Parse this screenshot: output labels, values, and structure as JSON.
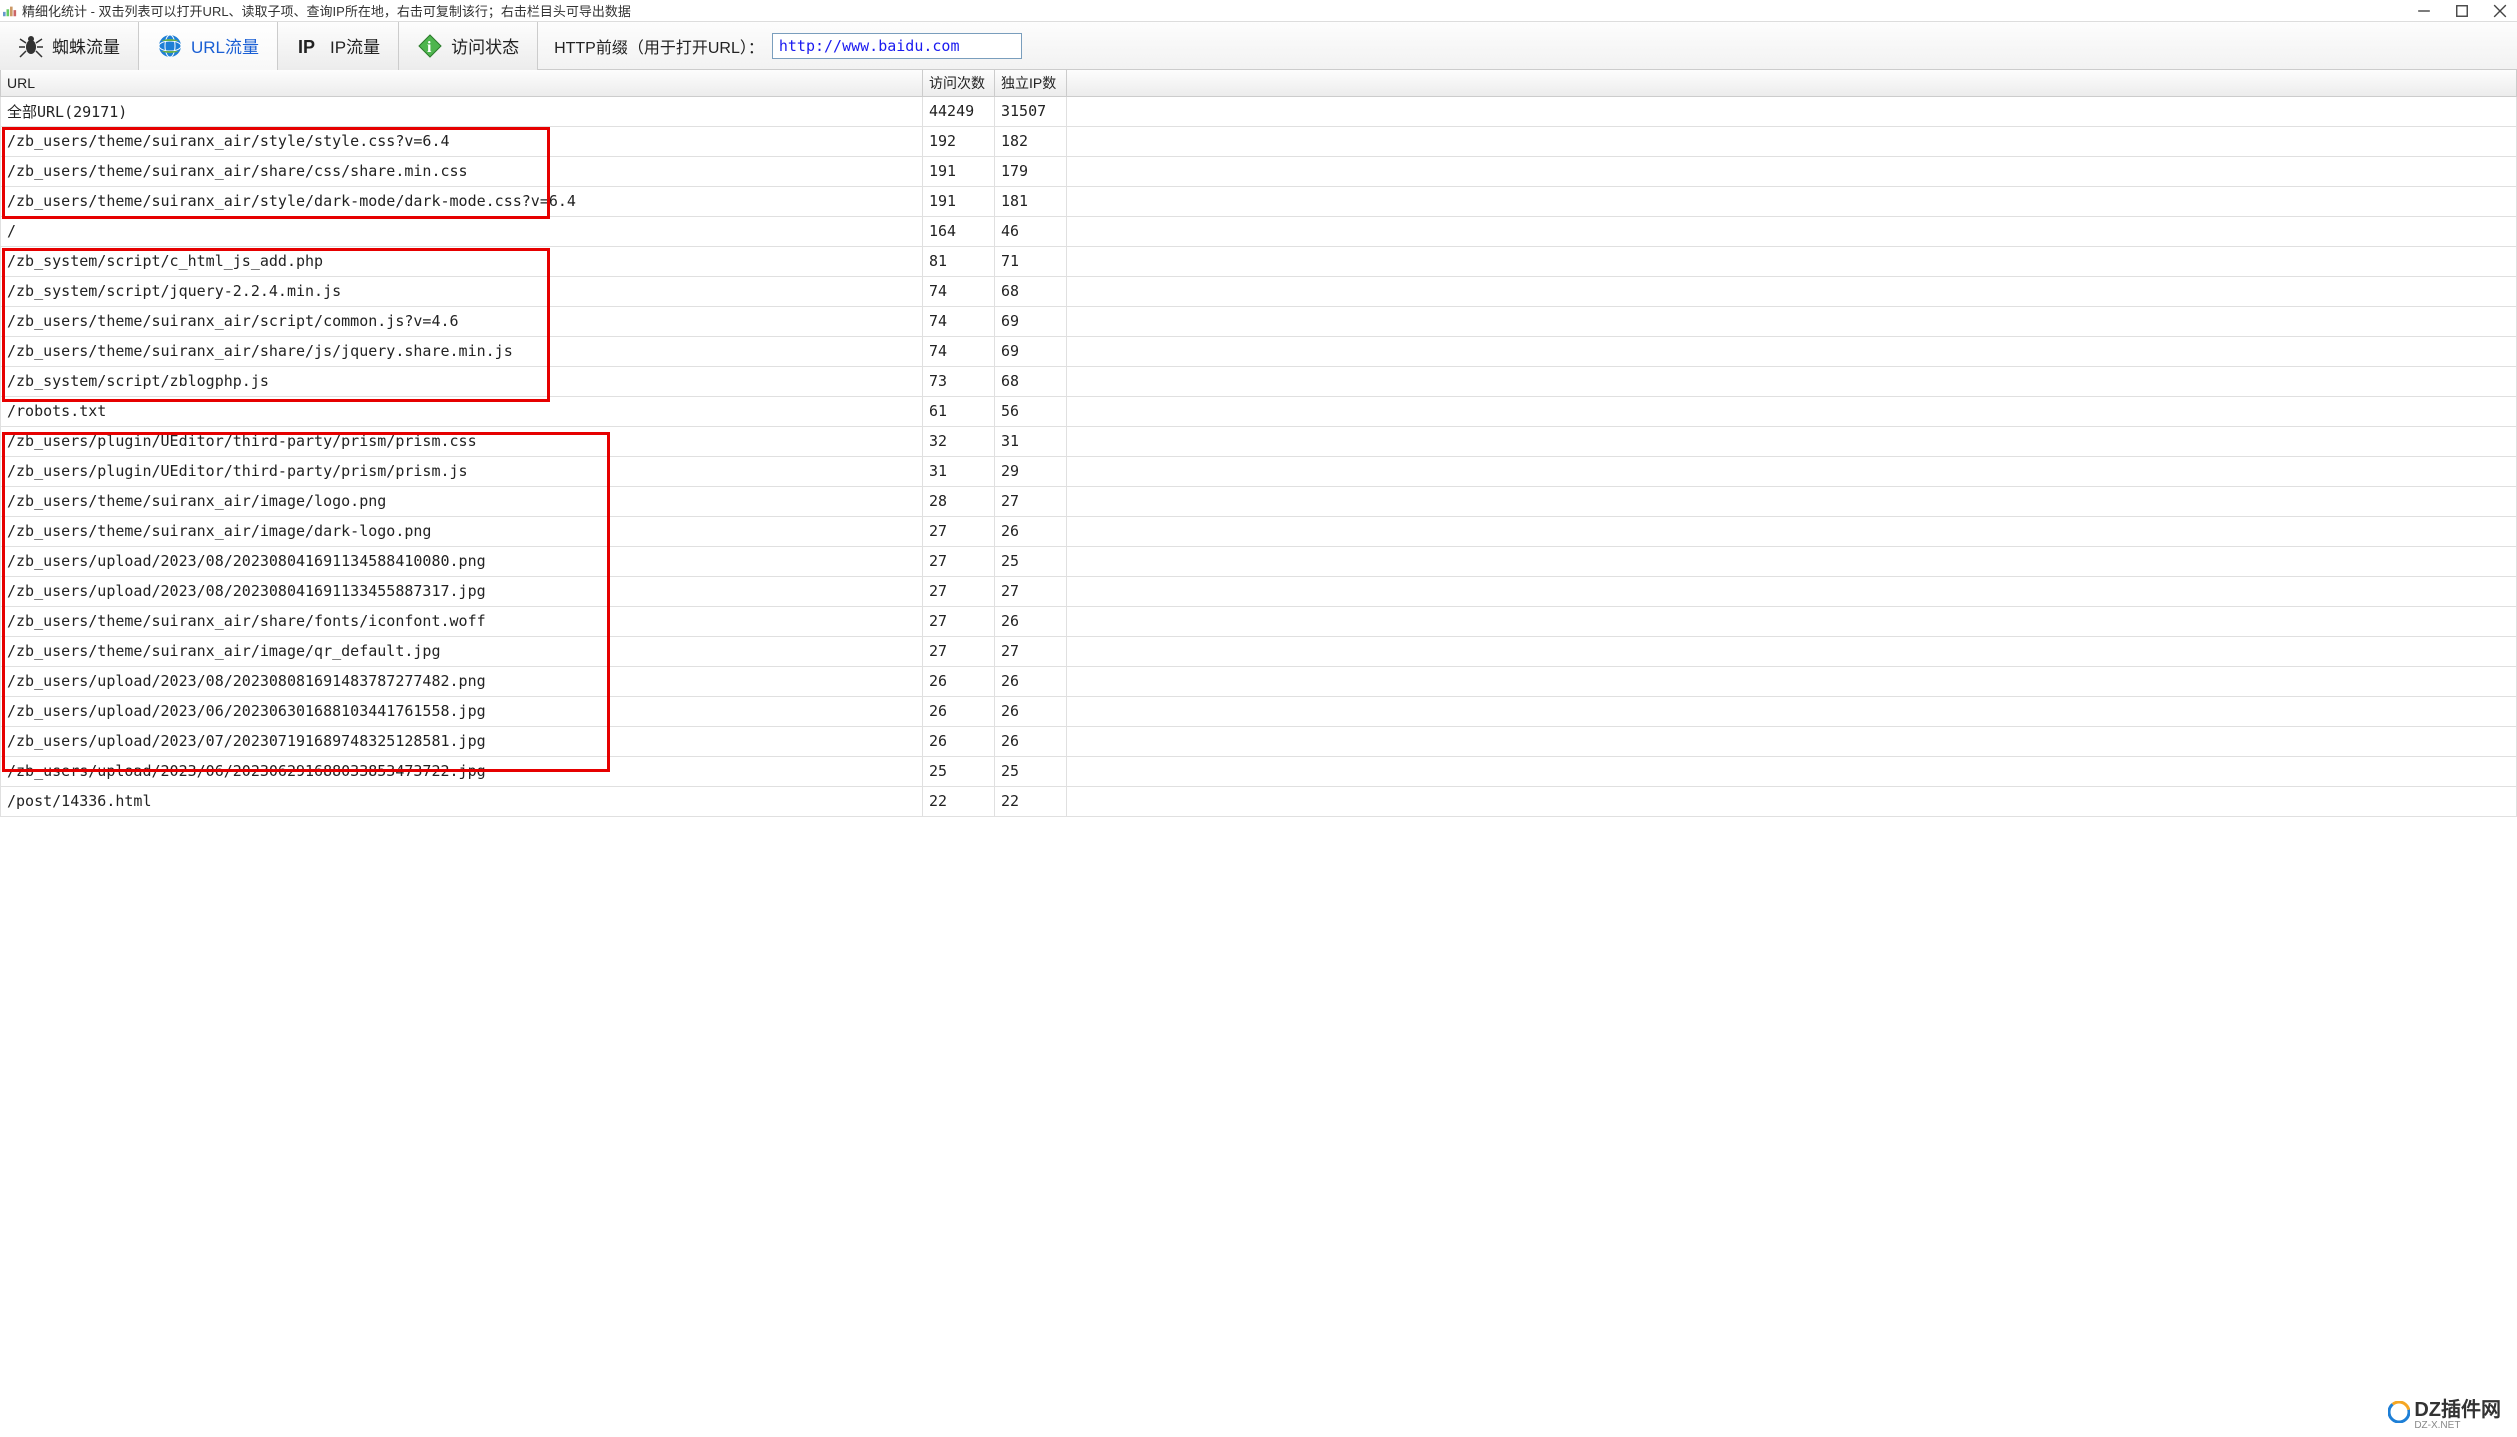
{
  "window": {
    "title": "精细化统计 - 双击列表可以打开URL、读取子项、查询IP所在地，右击可复制该行；右击栏目头可导出数据"
  },
  "tabs": {
    "spider": "蜘蛛流量",
    "url": "URL流量",
    "ip": "IP流量",
    "status": "访问状态"
  },
  "prefix": {
    "label": "HTTP前缀（用于打开URL）：",
    "value": "http://www.baidu.com"
  },
  "columns": {
    "url": "URL",
    "visits": "访问次数",
    "ip": "独立IP数"
  },
  "rows": [
    {
      "url": "全部URL(29171)",
      "visits": "44249",
      "ip": "31507"
    },
    {
      "url": "/zb_users/theme/suiranx_air/style/style.css?v=6.4",
      "visits": "192",
      "ip": "182"
    },
    {
      "url": "/zb_users/theme/suiranx_air/share/css/share.min.css",
      "visits": "191",
      "ip": "179"
    },
    {
      "url": "/zb_users/theme/suiranx_air/style/dark-mode/dark-mode.css?v=6.4",
      "visits": "191",
      "ip": "181"
    },
    {
      "url": "/",
      "visits": "164",
      "ip": "46"
    },
    {
      "url": "/zb_system/script/c_html_js_add.php",
      "visits": "81",
      "ip": "71"
    },
    {
      "url": "/zb_system/script/jquery-2.2.4.min.js",
      "visits": "74",
      "ip": "68"
    },
    {
      "url": "/zb_users/theme/suiranx_air/script/common.js?v=4.6",
      "visits": "74",
      "ip": "69"
    },
    {
      "url": "/zb_users/theme/suiranx_air/share/js/jquery.share.min.js",
      "visits": "74",
      "ip": "69"
    },
    {
      "url": "/zb_system/script/zblogphp.js",
      "visits": "73",
      "ip": "68"
    },
    {
      "url": "/robots.txt",
      "visits": "61",
      "ip": "56"
    },
    {
      "url": "/zb_users/plugin/UEditor/third-party/prism/prism.css",
      "visits": "32",
      "ip": "31"
    },
    {
      "url": "/zb_users/plugin/UEditor/third-party/prism/prism.js",
      "visits": "31",
      "ip": "29"
    },
    {
      "url": "/zb_users/theme/suiranx_air/image/logo.png",
      "visits": "28",
      "ip": "27"
    },
    {
      "url": "/zb_users/theme/suiranx_air/image/dark-logo.png",
      "visits": "27",
      "ip": "26"
    },
    {
      "url": "/zb_users/upload/2023/08/202308041691134588410080.png",
      "visits": "27",
      "ip": "25"
    },
    {
      "url": "/zb_users/upload/2023/08/202308041691133455887317.jpg",
      "visits": "27",
      "ip": "27"
    },
    {
      "url": "/zb_users/theme/suiranx_air/share/fonts/iconfont.woff",
      "visits": "27",
      "ip": "26"
    },
    {
      "url": "/zb_users/theme/suiranx_air/image/qr_default.jpg",
      "visits": "27",
      "ip": "27"
    },
    {
      "url": "/zb_users/upload/2023/08/202308081691483787277482.png",
      "visits": "26",
      "ip": "26"
    },
    {
      "url": "/zb_users/upload/2023/06/202306301688103441761558.jpg",
      "visits": "26",
      "ip": "26"
    },
    {
      "url": "/zb_users/upload/2023/07/202307191689748325128581.jpg",
      "visits": "26",
      "ip": "26"
    },
    {
      "url": "/zb_users/upload/2023/06/202306291688033853473722.jpg",
      "visits": "25",
      "ip": "25"
    },
    {
      "url": "/post/14336.html",
      "visits": "22",
      "ip": "22"
    }
  ],
  "watermark": {
    "brand": "DZ插件网",
    "sub": "DZ-X.NET"
  }
}
